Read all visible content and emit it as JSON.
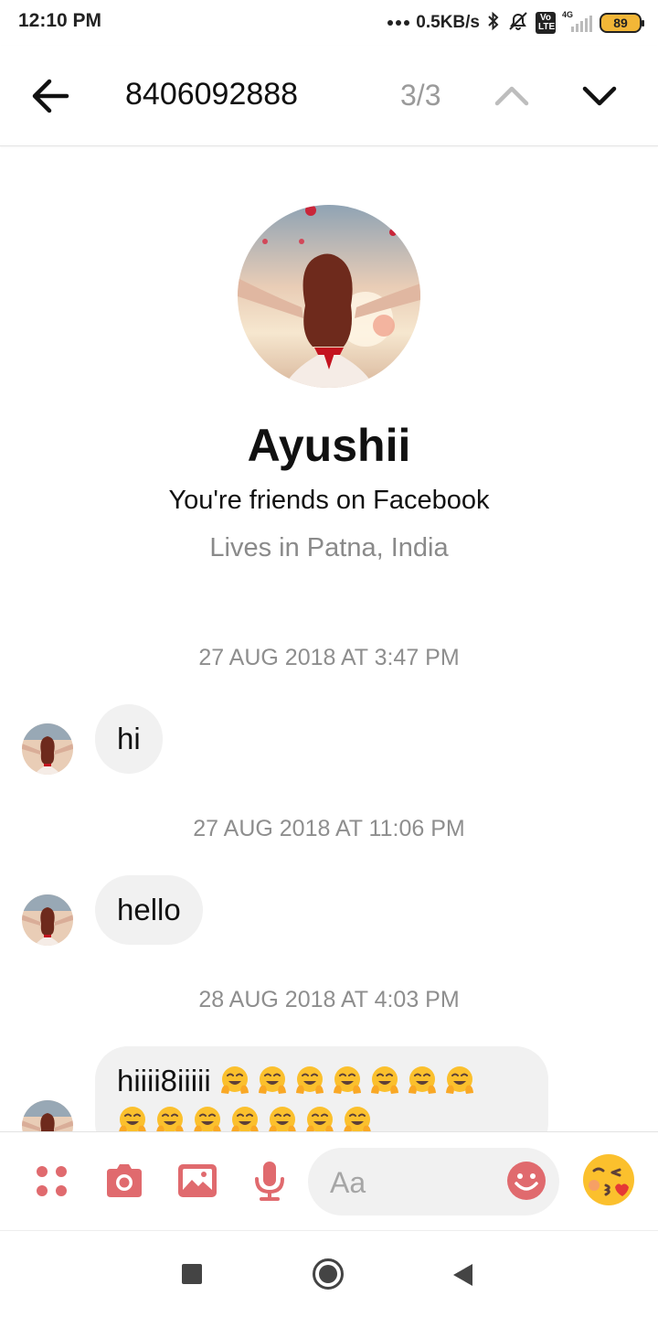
{
  "status_bar": {
    "time": "12:10 PM",
    "network_speed": "0.5KB/s",
    "network_type": "4G",
    "volte_label": "Vo LTE",
    "battery_level": "89",
    "icons": [
      "signal-dots-icon",
      "bluetooth-icon",
      "alarm-off-icon",
      "volte-icon",
      "signal-strength-icon",
      "battery-icon"
    ]
  },
  "search_bar": {
    "query": "8406092888",
    "match_counter": "3/3",
    "icons": [
      "back-arrow-icon",
      "chevron-up-icon",
      "chevron-down-icon"
    ]
  },
  "profile": {
    "name": "Ayushii",
    "relationship": "You're friends on Facebook",
    "location": "Lives in Patna, India"
  },
  "messages": [
    {
      "timestamp": "27 AUG 2018 AT 3:47 PM",
      "text": "hi"
    },
    {
      "timestamp": "27 AUG 2018 AT 11:06 PM",
      "text": "hello"
    },
    {
      "timestamp": "28 AUG 2018 AT 4:03 PM",
      "text": "hiiii8iiiii",
      "emoji_count": 14,
      "emoji": "hugging-face"
    }
  ],
  "composer": {
    "placeholder": "Aa",
    "icons": [
      "more-dots-icon",
      "camera-icon",
      "gallery-icon",
      "microphone-icon",
      "emoji-smile-icon",
      "kiss-emoji-icon"
    ],
    "accent_color": "#e06a6e"
  },
  "nav_bar": {
    "icons": [
      "recent-apps-icon",
      "home-icon",
      "back-icon"
    ]
  }
}
